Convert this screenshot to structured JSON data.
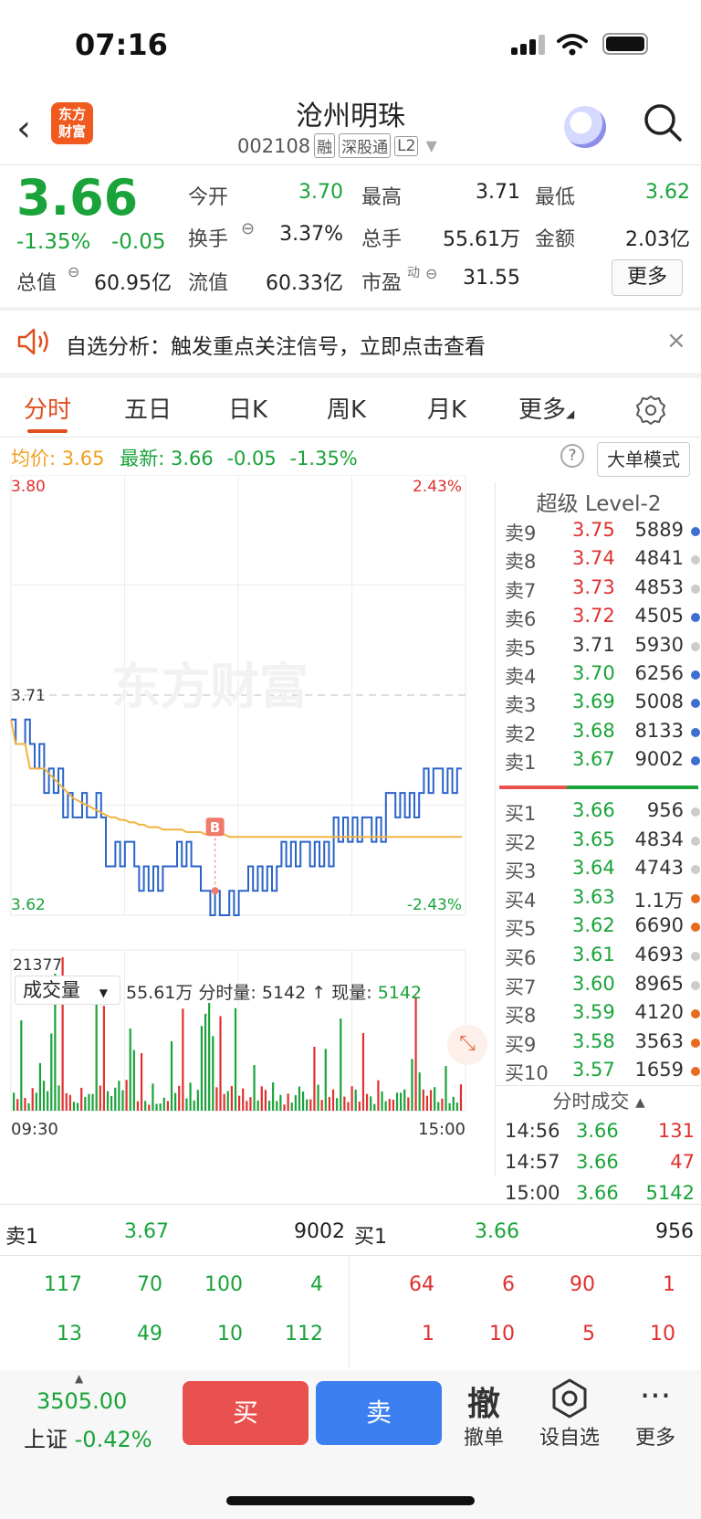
{
  "status_bar": {
    "time": "07:16"
  },
  "header": {
    "logo_top": "东方",
    "logo_bottom": "财富",
    "stock_name": "沧州明珠",
    "code": "002108",
    "tags": [
      "融",
      "深股通",
      "L2"
    ]
  },
  "quote": {
    "price": "3.66",
    "change_pct": "-1.35%",
    "change": "-0.05",
    "open_label": "今开",
    "open": "3.70",
    "high_label": "最高",
    "high": "3.71",
    "low_label": "最低",
    "low": "3.62",
    "turnover_label": "换手",
    "turnover": "3.37%",
    "volume_label": "总手",
    "volume": "55.61万",
    "amount_label": "金额",
    "amount": "2.03亿",
    "mktcap_label": "总值",
    "mktcap": "60.95亿",
    "float_label": "流值",
    "float_cap": "60.33亿",
    "pe_label": "市盈",
    "pe_sup": "动",
    "pe": "31.55",
    "more": "更多"
  },
  "notice": {
    "text": "自选分析：触发重点关注信号，立即点击查看",
    "close": "×"
  },
  "tabs": [
    "分时",
    "五日",
    "日K",
    "周K",
    "月K",
    "更多"
  ],
  "infoline": {
    "avg_label": "均价:",
    "avg": "3.65",
    "latest_label": "最新:",
    "latest": "3.66",
    "chg": "-0.05",
    "pct": "-1.35%",
    "big_mode": "大单模式"
  },
  "chart_data": {
    "type": "line",
    "y_top": "3.80",
    "y_bottom": "3.62",
    "y_ref": "3.71",
    "pct_top": "2.43%",
    "pct_bottom": "-2.43%",
    "ylim": [
      3.62,
      3.8
    ],
    "prev_close": 3.71,
    "x_start": "09:30",
    "x_end": "15:00",
    "watermark": "东方财富",
    "trade_marker": "B",
    "series": [
      {
        "name": "price",
        "color": "#2a63c9",
        "values": [
          3.7,
          3.69,
          3.69,
          3.7,
          3.69,
          3.68,
          3.69,
          3.67,
          3.68,
          3.67,
          3.68,
          3.66,
          3.67,
          3.66,
          3.66,
          3.67,
          3.66,
          3.66,
          3.67,
          3.66,
          3.64,
          3.64,
          3.65,
          3.64,
          3.65,
          3.65,
          3.64,
          3.63,
          3.64,
          3.63,
          3.64,
          3.63,
          3.64,
          3.64,
          3.64,
          3.65,
          3.64,
          3.65,
          3.64,
          3.64,
          3.63,
          3.63,
          3.62,
          3.63,
          3.62,
          3.62,
          3.63,
          3.62,
          3.63,
          3.63,
          3.64,
          3.63,
          3.64,
          3.63,
          3.64,
          3.63,
          3.64,
          3.65,
          3.64,
          3.65,
          3.64,
          3.65,
          3.65,
          3.64,
          3.65,
          3.64,
          3.65,
          3.64,
          3.66,
          3.65,
          3.66,
          3.65,
          3.66,
          3.65,
          3.66,
          3.66,
          3.65,
          3.66,
          3.65,
          3.67,
          3.67,
          3.66,
          3.67,
          3.66,
          3.67,
          3.66,
          3.67,
          3.68,
          3.67,
          3.68,
          3.68,
          3.67,
          3.68,
          3.67,
          3.68,
          3.68
        ]
      },
      {
        "name": "avg",
        "color": "#f3b340",
        "values": [
          3.7,
          3.69,
          3.69,
          3.69,
          3.68,
          3.68,
          3.68,
          3.68,
          3.678,
          3.676,
          3.674,
          3.672,
          3.67,
          3.668,
          3.667,
          3.666,
          3.665,
          3.664,
          3.663,
          3.662,
          3.661,
          3.66,
          3.66,
          3.659,
          3.659,
          3.658,
          3.658,
          3.657,
          3.657,
          3.656,
          3.656,
          3.656,
          3.655,
          3.655,
          3.655,
          3.655,
          3.655,
          3.654,
          3.654,
          3.654,
          3.654,
          3.653,
          3.653,
          3.653,
          3.653,
          3.653,
          3.652,
          3.652,
          3.652,
          3.652,
          3.652,
          3.652,
          3.652,
          3.652,
          3.652,
          3.652,
          3.652,
          3.652,
          3.652,
          3.652,
          3.652,
          3.652,
          3.652,
          3.652,
          3.652,
          3.652,
          3.652,
          3.652,
          3.652,
          3.652,
          3.652,
          3.652,
          3.652,
          3.652,
          3.652,
          3.652,
          3.652,
          3.652,
          3.652,
          3.652,
          3.652,
          3.652,
          3.652,
          3.652,
          3.652,
          3.652,
          3.652,
          3.652,
          3.652,
          3.652,
          3.652,
          3.652,
          3.652,
          3.652,
          3.652,
          3.652
        ]
      }
    ],
    "volume_label": "成交量",
    "volume_info": "55.61万 分时量: 5142 ↑ 现量:",
    "volume_now": "5142",
    "volume_max": "21377"
  },
  "level2": {
    "title": "超级 Level-2",
    "asks": [
      {
        "label": "卖9",
        "price": "3.75",
        "vol": "5889",
        "pc": "#e03030",
        "dot": "#3c6fd0"
      },
      {
        "label": "卖8",
        "price": "3.74",
        "vol": "4841",
        "pc": "#e03030",
        "dot": "#ccc"
      },
      {
        "label": "卖7",
        "price": "3.73",
        "vol": "4853",
        "pc": "#e03030",
        "dot": "#ccc"
      },
      {
        "label": "卖6",
        "price": "3.72",
        "vol": "4505",
        "pc": "#e03030",
        "dot": "#3c6fd0"
      },
      {
        "label": "卖5",
        "price": "3.71",
        "vol": "5930",
        "pc": "#333",
        "dot": "#ccc"
      },
      {
        "label": "卖4",
        "price": "3.70",
        "vol": "6256",
        "pc": "#1aa33a",
        "dot": "#3c6fd0"
      },
      {
        "label": "卖3",
        "price": "3.69",
        "vol": "5008",
        "pc": "#1aa33a",
        "dot": "#3c6fd0"
      },
      {
        "label": "卖2",
        "price": "3.68",
        "vol": "8133",
        "pc": "#1aa33a",
        "dot": "#3c6fd0"
      },
      {
        "label": "卖1",
        "price": "3.67",
        "vol": "9002",
        "pc": "#1aa33a",
        "dot": "#3c6fd0"
      }
    ],
    "bids": [
      {
        "label": "买1",
        "price": "3.66",
        "vol": "956",
        "pc": "#1aa33a",
        "dot": "#ccc"
      },
      {
        "label": "买2",
        "price": "3.65",
        "vol": "4834",
        "pc": "#1aa33a",
        "dot": "#ccc"
      },
      {
        "label": "买3",
        "price": "3.64",
        "vol": "4743",
        "pc": "#1aa33a",
        "dot": "#ccc"
      },
      {
        "label": "买4",
        "price": "3.63",
        "vol": "1.1万",
        "pc": "#1aa33a",
        "dot": "#e86a1e"
      },
      {
        "label": "买5",
        "price": "3.62",
        "vol": "6690",
        "pc": "#1aa33a",
        "dot": "#e86a1e"
      },
      {
        "label": "买6",
        "price": "3.61",
        "vol": "4693",
        "pc": "#1aa33a",
        "dot": "#ccc"
      },
      {
        "label": "买7",
        "price": "3.60",
        "vol": "8965",
        "pc": "#1aa33a",
        "dot": "#ccc"
      },
      {
        "label": "买8",
        "price": "3.59",
        "vol": "4120",
        "pc": "#1aa33a",
        "dot": "#e86a1e"
      },
      {
        "label": "买9",
        "price": "3.58",
        "vol": "3563",
        "pc": "#1aa33a",
        "dot": "#e86a1e"
      },
      {
        "label": "买10",
        "price": "3.57",
        "vol": "1659",
        "pc": "#1aa33a",
        "dot": "#e86a1e"
      }
    ],
    "ticks_title": "分时成交",
    "ticks": [
      {
        "time": "14:56",
        "price": "3.66",
        "vol": "131",
        "vc": "#e03030"
      },
      {
        "time": "14:57",
        "price": "3.66",
        "vol": "47",
        "vc": "#e03030"
      },
      {
        "time": "15:00",
        "price": "3.66",
        "vol": "5142",
        "vc": "#1aa33a"
      }
    ]
  },
  "book": {
    "ask_label": "卖1",
    "ask_price": "3.67",
    "ask_vol": "9002",
    "bid_label": "买1",
    "bid_price": "3.66",
    "bid_vol": "956",
    "ask_orders": [
      [
        "117",
        "70",
        "100",
        "4"
      ],
      [
        "13",
        "49",
        "10",
        "112"
      ]
    ],
    "bid_orders": [
      [
        "64",
        "6",
        "90",
        "1"
      ],
      [
        "1",
        "10",
        "5",
        "10"
      ]
    ]
  },
  "footer": {
    "index_value": "3505.00",
    "index_name": "上证",
    "index_pct": "-0.42%",
    "buy": "买",
    "sell": "卖",
    "cancel_icon": "撤",
    "cancel": "撤单",
    "watch": "设自选",
    "more": "更多"
  }
}
